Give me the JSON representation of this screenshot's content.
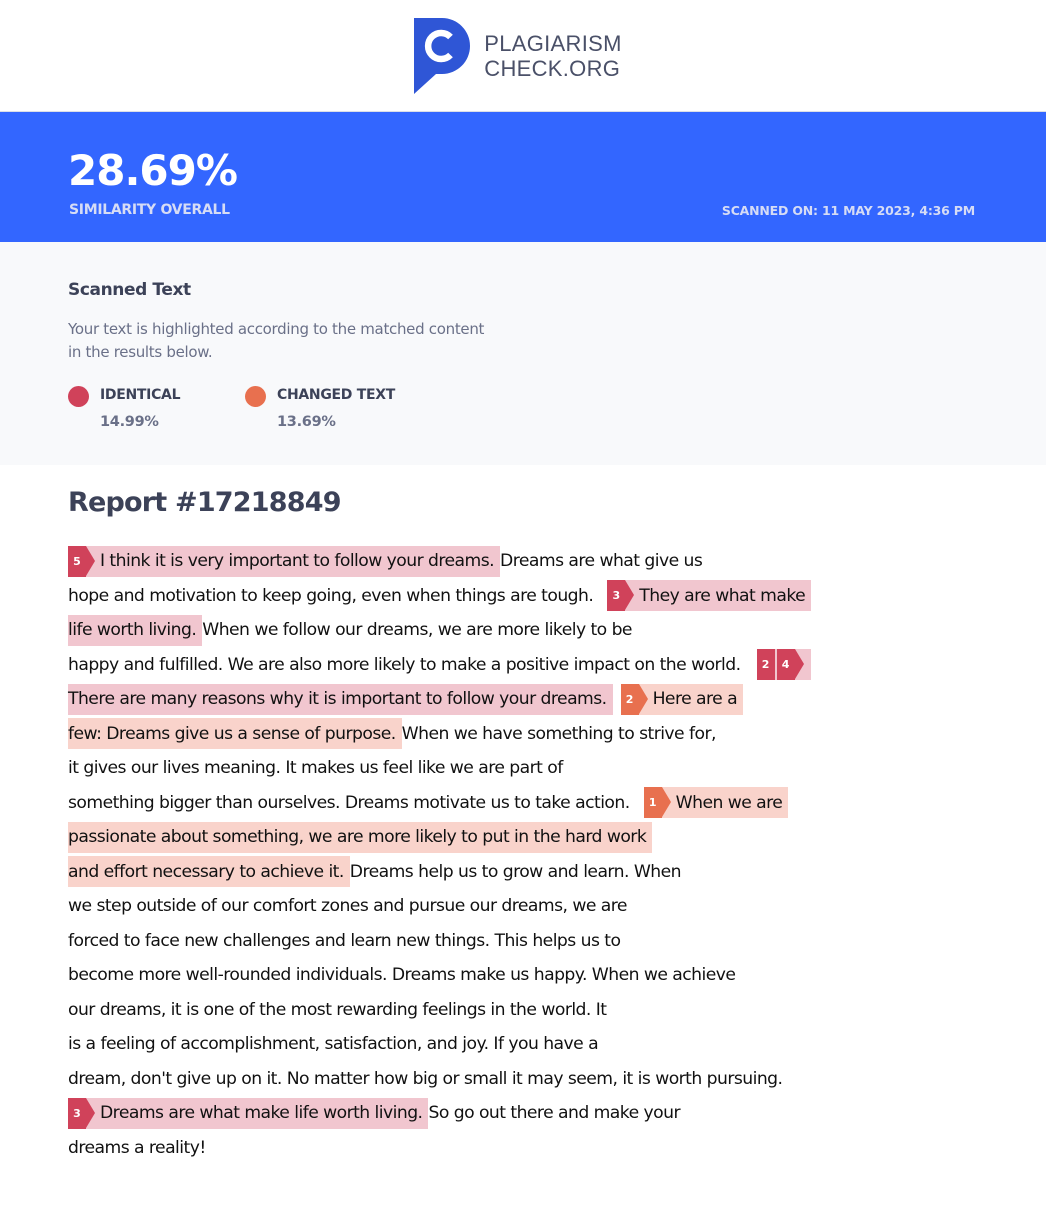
{
  "brand": {
    "line1": "PLAGIARISM",
    "line2": "CHECK.ORG",
    "logo_icon": "speech-bubble-c-icon",
    "color": "#2f56d6"
  },
  "banner": {
    "similarity": "28.69%",
    "similarity_label": "SIMILARITY OVERALL",
    "scanned_on": "SCANNED ON: 11 MAY 2023, 4:36 PM",
    "background": "#3366ff"
  },
  "summary": {
    "title": "Scanned Text",
    "description": "Your text is highlighted according to the matched content in the results below.",
    "legend": [
      {
        "label": "IDENTICAL",
        "percent": "14.99%",
        "color": "#d0425a"
      },
      {
        "label": "CHANGED TEXT",
        "percent": "13.69%",
        "color": "#e8704f"
      }
    ]
  },
  "report": {
    "title": "Report #17218849",
    "lines": [
      [
        {
          "type": "identical",
          "badges": [
            "5"
          ],
          "text": "I think it is very important to follow your dreams."
        },
        {
          "type": "plain",
          "text": "Dreams are what give us"
        }
      ],
      [
        {
          "type": "plain",
          "text": "hope and motivation to keep going, even when things are tough."
        },
        {
          "type": "identical",
          "badges": [
            "3"
          ],
          "text": "They are what make"
        }
      ],
      [
        {
          "type": "identical",
          "text": "life worth living."
        },
        {
          "type": "plain",
          "text": "When we follow our dreams, we are more likely to be"
        }
      ],
      [
        {
          "type": "plain",
          "text": "happy and fulfilled. We are also more likely to make a positive impact on the world."
        },
        {
          "type": "badgegroup",
          "badges": [
            "2",
            "4"
          ]
        }
      ],
      [
        {
          "type": "identical",
          "text": "There are many reasons why it is important to follow your dreams."
        },
        {
          "type": "changed",
          "badges": [
            "2"
          ],
          "text": "Here are a"
        }
      ],
      [
        {
          "type": "changed",
          "text": "few: Dreams give us a sense of purpose."
        },
        {
          "type": "plain",
          "text": "When we have something to strive for,"
        }
      ],
      [
        {
          "type": "plain",
          "text": "it gives our lives meaning. It makes us feel like we are part of"
        }
      ],
      [
        {
          "type": "plain",
          "text": "something bigger than ourselves. Dreams motivate us to take action."
        },
        {
          "type": "changed",
          "badges": [
            "1"
          ],
          "text": "When we are"
        }
      ],
      [
        {
          "type": "changed",
          "text": "passionate about something, we are more likely to put in the hard work"
        }
      ],
      [
        {
          "type": "changed",
          "text": "and effort necessary to achieve it."
        },
        {
          "type": "plain",
          "text": "Dreams help us to grow and learn. When"
        }
      ],
      [
        {
          "type": "plain",
          "text": "we step outside of our comfort zones and pursue our dreams, we are"
        }
      ],
      [
        {
          "type": "plain",
          "text": "forced to face new challenges and learn new things. This helps us to"
        }
      ],
      [
        {
          "type": "plain",
          "text": "become more well-rounded individuals. Dreams make us happy. When we achieve"
        }
      ],
      [
        {
          "type": "plain",
          "text": "our dreams, it is one of the most rewarding feelings in the world. It"
        }
      ],
      [
        {
          "type": "plain",
          "text": "is a feeling of accomplishment, satisfaction, and joy. If you have a"
        }
      ],
      [
        {
          "type": "plain",
          "text": "dream, don't give up on it. No matter how big or small it may seem, it is worth pursuing."
        }
      ],
      [
        {
          "type": "identical",
          "badges": [
            "3"
          ],
          "text": "Dreams are what make life worth living."
        },
        {
          "type": "plain",
          "text": "So go out there and make your"
        }
      ],
      [
        {
          "type": "plain",
          "text": "dreams a reality!"
        }
      ]
    ]
  }
}
